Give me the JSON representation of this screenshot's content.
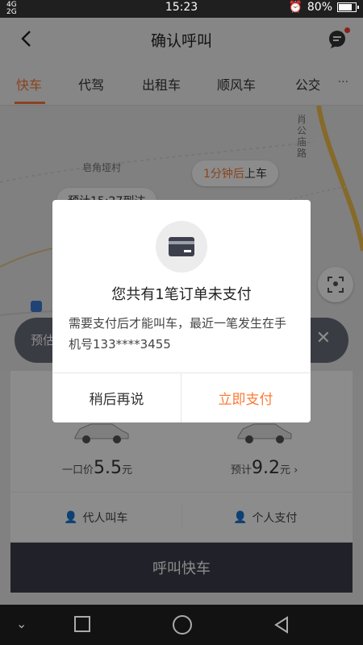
{
  "status_bar": {
    "time": "15:23",
    "network_a": "4G",
    "network_b": "2G",
    "battery_percent": "80%",
    "battery_level": 0.8
  },
  "header": {
    "title": "确认呼叫"
  },
  "tabs": [
    {
      "label": "快车",
      "active": true
    },
    {
      "label": "代驾"
    },
    {
      "label": "出租车"
    },
    {
      "label": "顺风车"
    },
    {
      "label": "公交"
    }
  ],
  "tabs_more": "···",
  "map": {
    "labels": {
      "village": "皂角垭村",
      "road": "肖公庙路"
    },
    "pickup_bubble": {
      "highlight": "1分钟后",
      "text": "上车"
    },
    "eta_top": "预计15:27到达",
    "eta_bar": "预估"
  },
  "panel": {
    "left_price": {
      "prefix": "一口价",
      "value": "5.5",
      "unit": "元"
    },
    "right_price": {
      "prefix": "预计",
      "value": "9.2",
      "unit": "元",
      "chevron": "›"
    },
    "option_proxy": "代人叫车",
    "option_pay": "个人支付",
    "call_button": "呼叫快车"
  },
  "dialog": {
    "title": "您共有1笔订单未支付",
    "body": "需要支付后才能叫车，最近一笔发生在手机号133****3455",
    "later_button": "稍后再说",
    "pay_button": "立即支付"
  },
  "colors": {
    "accent": "#fc7a36",
    "dark_button": "#3d3f4c"
  }
}
